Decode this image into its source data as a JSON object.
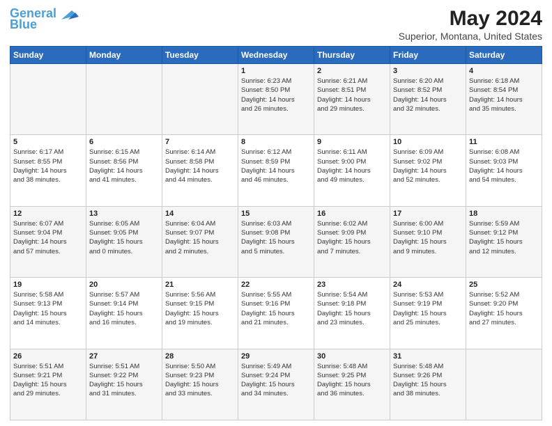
{
  "app": {
    "logo_line1": "General",
    "logo_line2": "Blue",
    "title": "May 2024",
    "subtitle": "Superior, Montana, United States"
  },
  "calendar": {
    "days_of_week": [
      "Sunday",
      "Monday",
      "Tuesday",
      "Wednesday",
      "Thursday",
      "Friday",
      "Saturday"
    ],
    "weeks": [
      [
        {
          "day": "",
          "content": ""
        },
        {
          "day": "",
          "content": ""
        },
        {
          "day": "",
          "content": ""
        },
        {
          "day": "1",
          "content": "Sunrise: 6:23 AM\nSunset: 8:50 PM\nDaylight: 14 hours\nand 26 minutes."
        },
        {
          "day": "2",
          "content": "Sunrise: 6:21 AM\nSunset: 8:51 PM\nDaylight: 14 hours\nand 29 minutes."
        },
        {
          "day": "3",
          "content": "Sunrise: 6:20 AM\nSunset: 8:52 PM\nDaylight: 14 hours\nand 32 minutes."
        },
        {
          "day": "4",
          "content": "Sunrise: 6:18 AM\nSunset: 8:54 PM\nDaylight: 14 hours\nand 35 minutes."
        }
      ],
      [
        {
          "day": "5",
          "content": "Sunrise: 6:17 AM\nSunset: 8:55 PM\nDaylight: 14 hours\nand 38 minutes."
        },
        {
          "day": "6",
          "content": "Sunrise: 6:15 AM\nSunset: 8:56 PM\nDaylight: 14 hours\nand 41 minutes."
        },
        {
          "day": "7",
          "content": "Sunrise: 6:14 AM\nSunset: 8:58 PM\nDaylight: 14 hours\nand 44 minutes."
        },
        {
          "day": "8",
          "content": "Sunrise: 6:12 AM\nSunset: 8:59 PM\nDaylight: 14 hours\nand 46 minutes."
        },
        {
          "day": "9",
          "content": "Sunrise: 6:11 AM\nSunset: 9:00 PM\nDaylight: 14 hours\nand 49 minutes."
        },
        {
          "day": "10",
          "content": "Sunrise: 6:09 AM\nSunset: 9:02 PM\nDaylight: 14 hours\nand 52 minutes."
        },
        {
          "day": "11",
          "content": "Sunrise: 6:08 AM\nSunset: 9:03 PM\nDaylight: 14 hours\nand 54 minutes."
        }
      ],
      [
        {
          "day": "12",
          "content": "Sunrise: 6:07 AM\nSunset: 9:04 PM\nDaylight: 14 hours\nand 57 minutes."
        },
        {
          "day": "13",
          "content": "Sunrise: 6:05 AM\nSunset: 9:05 PM\nDaylight: 15 hours\nand 0 minutes."
        },
        {
          "day": "14",
          "content": "Sunrise: 6:04 AM\nSunset: 9:07 PM\nDaylight: 15 hours\nand 2 minutes."
        },
        {
          "day": "15",
          "content": "Sunrise: 6:03 AM\nSunset: 9:08 PM\nDaylight: 15 hours\nand 5 minutes."
        },
        {
          "day": "16",
          "content": "Sunrise: 6:02 AM\nSunset: 9:09 PM\nDaylight: 15 hours\nand 7 minutes."
        },
        {
          "day": "17",
          "content": "Sunrise: 6:00 AM\nSunset: 9:10 PM\nDaylight: 15 hours\nand 9 minutes."
        },
        {
          "day": "18",
          "content": "Sunrise: 5:59 AM\nSunset: 9:12 PM\nDaylight: 15 hours\nand 12 minutes."
        }
      ],
      [
        {
          "day": "19",
          "content": "Sunrise: 5:58 AM\nSunset: 9:13 PM\nDaylight: 15 hours\nand 14 minutes."
        },
        {
          "day": "20",
          "content": "Sunrise: 5:57 AM\nSunset: 9:14 PM\nDaylight: 15 hours\nand 16 minutes."
        },
        {
          "day": "21",
          "content": "Sunrise: 5:56 AM\nSunset: 9:15 PM\nDaylight: 15 hours\nand 19 minutes."
        },
        {
          "day": "22",
          "content": "Sunrise: 5:55 AM\nSunset: 9:16 PM\nDaylight: 15 hours\nand 21 minutes."
        },
        {
          "day": "23",
          "content": "Sunrise: 5:54 AM\nSunset: 9:18 PM\nDaylight: 15 hours\nand 23 minutes."
        },
        {
          "day": "24",
          "content": "Sunrise: 5:53 AM\nSunset: 9:19 PM\nDaylight: 15 hours\nand 25 minutes."
        },
        {
          "day": "25",
          "content": "Sunrise: 5:52 AM\nSunset: 9:20 PM\nDaylight: 15 hours\nand 27 minutes."
        }
      ],
      [
        {
          "day": "26",
          "content": "Sunrise: 5:51 AM\nSunset: 9:21 PM\nDaylight: 15 hours\nand 29 minutes."
        },
        {
          "day": "27",
          "content": "Sunrise: 5:51 AM\nSunset: 9:22 PM\nDaylight: 15 hours\nand 31 minutes."
        },
        {
          "day": "28",
          "content": "Sunrise: 5:50 AM\nSunset: 9:23 PM\nDaylight: 15 hours\nand 33 minutes."
        },
        {
          "day": "29",
          "content": "Sunrise: 5:49 AM\nSunset: 9:24 PM\nDaylight: 15 hours\nand 34 minutes."
        },
        {
          "day": "30",
          "content": "Sunrise: 5:48 AM\nSunset: 9:25 PM\nDaylight: 15 hours\nand 36 minutes."
        },
        {
          "day": "31",
          "content": "Sunrise: 5:48 AM\nSunset: 9:26 PM\nDaylight: 15 hours\nand 38 minutes."
        },
        {
          "day": "",
          "content": ""
        }
      ]
    ]
  }
}
